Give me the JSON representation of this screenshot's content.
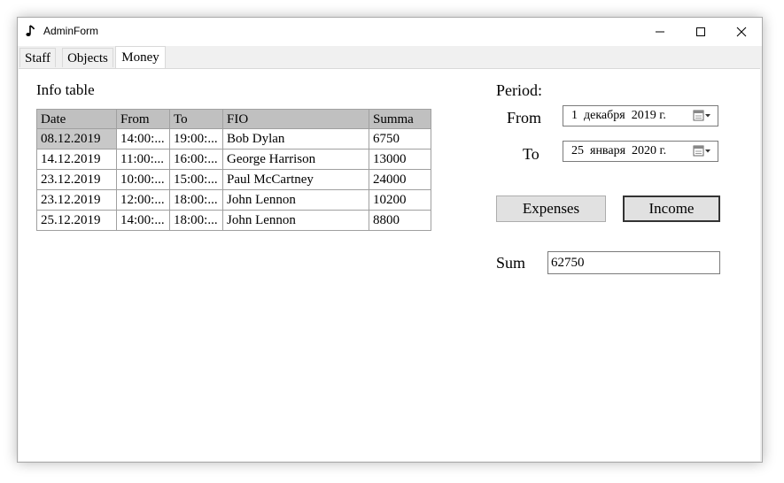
{
  "window": {
    "title": "AdminForm",
    "controls": {
      "minimize": "minimize-icon",
      "maximize": "maximize-icon",
      "close": "close-icon"
    }
  },
  "tabs": [
    {
      "label": "Staff",
      "selected": false
    },
    {
      "label": "Objects",
      "selected": false
    },
    {
      "label": "Money",
      "selected": true
    }
  ],
  "info": {
    "title": "Info table",
    "columns": [
      "Date",
      "From",
      "To",
      "FIO",
      "Summa"
    ],
    "rows": [
      {
        "date": "08.12.2019",
        "from": "14:00:...",
        "to": "19:00:...",
        "fio": "Bob Dylan",
        "summa": "6750"
      },
      {
        "date": "14.12.2019",
        "from": "11:00:...",
        "to": "16:00:...",
        "fio": "George Harrison",
        "summa": "13000"
      },
      {
        "date": "23.12.2019",
        "from": "10:00:...",
        "to": "15:00:...",
        "fio": "Paul McCartney",
        "summa": "24000"
      },
      {
        "date": "23.12.2019",
        "from": "12:00:...",
        "to": "18:00:...",
        "fio": "John Lennon",
        "summa": "10200"
      },
      {
        "date": "25.12.2019",
        "from": "14:00:...",
        "to": "18:00:...",
        "fio": "John Lennon",
        "summa": "8800"
      }
    ]
  },
  "period": {
    "label": "Period:",
    "from_label": "From",
    "from_value": "1  декабря  2019 г.",
    "to_label": "To",
    "to_value": "25  января  2020 г."
  },
  "buttons": {
    "expenses": "Expenses",
    "income": "Income"
  },
  "sum": {
    "label": "Sum",
    "value": "62750"
  }
}
